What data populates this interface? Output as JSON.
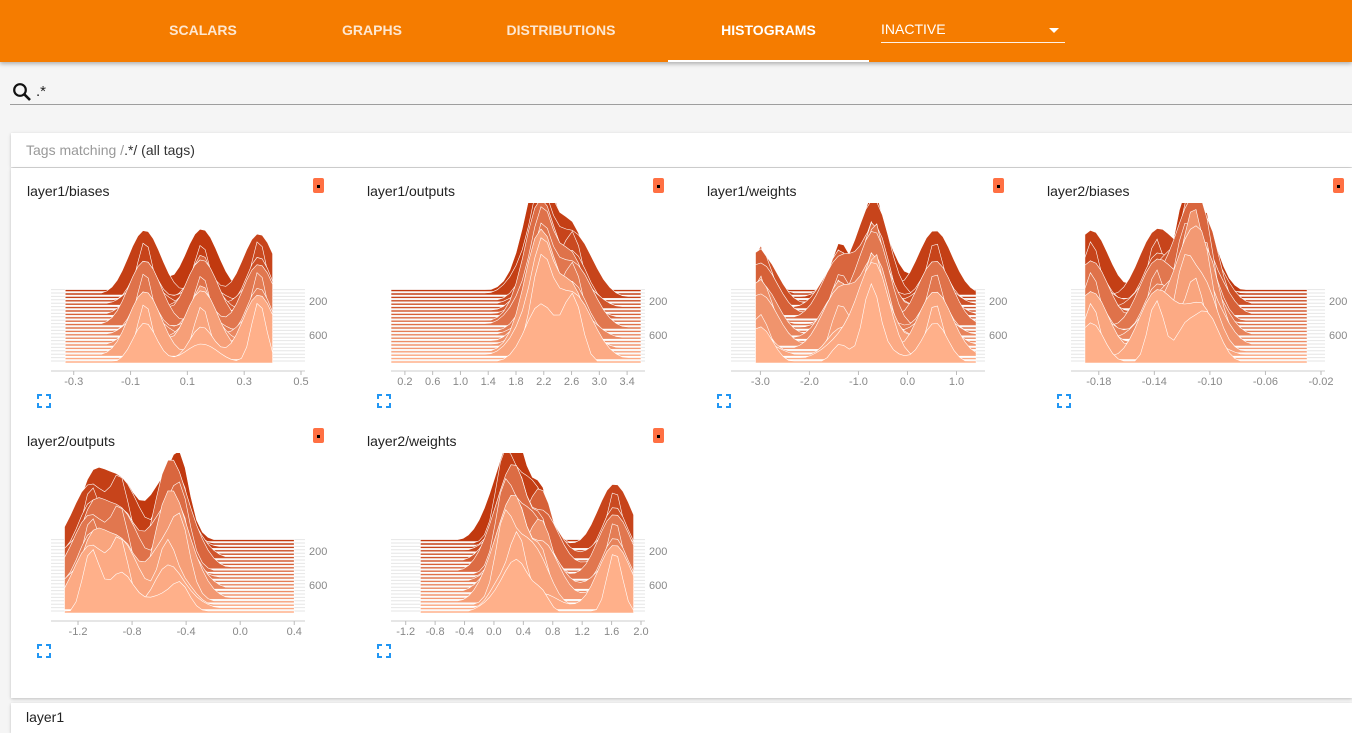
{
  "nav": {
    "tabs": [
      {
        "label": "SCALARS",
        "active": false
      },
      {
        "label": "GRAPHS",
        "active": false
      },
      {
        "label": "DISTRIBUTIONS",
        "active": false
      },
      {
        "label": "HISTOGRAMS",
        "active": true
      }
    ],
    "run_selector": {
      "value": "INACTIVE",
      "icon": "caret-down-icon"
    }
  },
  "search": {
    "icon": "search-icon",
    "value": ".*"
  },
  "tag_group": {
    "prefix": "Tags matching /",
    "regex": ".*",
    "suffix": "/ (all tags)"
  },
  "next_group": {
    "label": "layer1"
  },
  "colors": {
    "header": "#f57c00",
    "series_dark": "#c1390f",
    "series_light": "#ffb08a",
    "run_chip": "#ff7043",
    "expand_icon": "#2196f3"
  },
  "cards": [
    {
      "title": "layer1/biases",
      "chart_data": {
        "type": "histogram",
        "x_ticks": [
          "-0.3",
          "-0.1",
          "0.1",
          "0.3",
          "0.5"
        ],
        "x_range": [
          -0.38,
          0.5
        ],
        "y_ticks": [
          "200",
          "600"
        ],
        "series_min": -0.33,
        "series_max": 0.4
      }
    },
    {
      "title": "layer1/outputs",
      "chart_data": {
        "type": "histogram",
        "x_ticks": [
          "0.2",
          "0.6",
          "1.0",
          "1.4",
          "1.8",
          "2.2",
          "2.6",
          "3.0",
          "3.4"
        ],
        "x_range": [
          0.0,
          3.6
        ],
        "y_ticks": [
          "200",
          "600"
        ],
        "series_min": 0.0,
        "series_max": 3.6
      }
    },
    {
      "title": "layer1/weights",
      "chart_data": {
        "type": "histogram",
        "x_ticks": [
          "-3.0",
          "-2.0",
          "-1.0",
          "0.0",
          "1.0"
        ],
        "x_range": [
          -3.6,
          1.5
        ],
        "y_ticks": [
          "200",
          "600"
        ],
        "series_min": -3.1,
        "series_max": 1.4
      }
    },
    {
      "title": "layer2/biases",
      "chart_data": {
        "type": "histogram",
        "x_ticks": [
          "-0.18",
          "-0.14",
          "-0.10",
          "-0.06",
          "-0.02"
        ],
        "x_range": [
          -0.2,
          -0.02
        ],
        "y_ticks": [
          "200",
          "600"
        ],
        "series_min": -0.19,
        "series_max": -0.03
      }
    },
    {
      "title": "layer2/outputs",
      "chart_data": {
        "type": "histogram",
        "x_ticks": [
          "-1.2",
          "-0.8",
          "-0.4",
          "0.0",
          "0.4"
        ],
        "x_range": [
          -1.4,
          0.45
        ],
        "y_ticks": [
          "200",
          "600"
        ],
        "series_min": -1.3,
        "series_max": 0.4
      }
    },
    {
      "title": "layer2/weights",
      "chart_data": {
        "type": "histogram",
        "x_ticks": [
          "-1.2",
          "-0.8",
          "-0.4",
          "0.0",
          "0.4",
          "0.8",
          "1.2",
          "1.6",
          "2.0"
        ],
        "x_range": [
          -1.4,
          2.0
        ],
        "y_ticks": [
          "200",
          "600"
        ],
        "series_min": -1.0,
        "series_max": 1.9
      }
    }
  ]
}
